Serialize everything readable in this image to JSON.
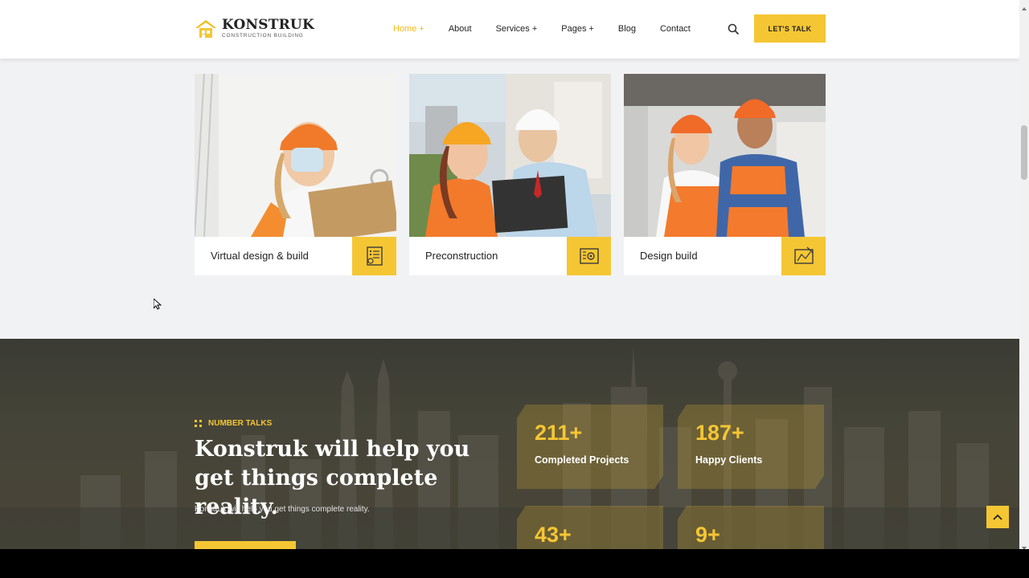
{
  "brand": {
    "name": "KONSTRUK",
    "tagline": "CONSTRUCTION BUILDING",
    "accent": "#f5c634"
  },
  "nav": {
    "items": [
      {
        "label": "Home +",
        "active": true
      },
      {
        "label": "About"
      },
      {
        "label": "Services +"
      },
      {
        "label": "Pages +"
      },
      {
        "label": "Blog"
      },
      {
        "label": "Contact"
      }
    ],
    "search_icon": "search-icon",
    "cta_label": "LET'S TALK"
  },
  "services": [
    {
      "title": "Virtual design & build",
      "icon": "blueprint-checklist-icon"
    },
    {
      "title": "Preconstruction",
      "icon": "blueprint-gear-icon"
    },
    {
      "title": "Design build",
      "icon": "drafting-plan-icon"
    }
  ],
  "stats_section": {
    "eyebrow": "NUMBER TALKS",
    "headline": "Konstruk will help you get things complete reality.",
    "subtext": "Konstruk will help you get things complete reality.",
    "stats": [
      {
        "value": "211+",
        "label": "Completed Projects"
      },
      {
        "value": "187+",
        "label": "Happy Clients"
      },
      {
        "value": "43+",
        "label": ""
      },
      {
        "value": "9+",
        "label": ""
      }
    ]
  },
  "back_to_top_icon": "chevron-up-icon"
}
